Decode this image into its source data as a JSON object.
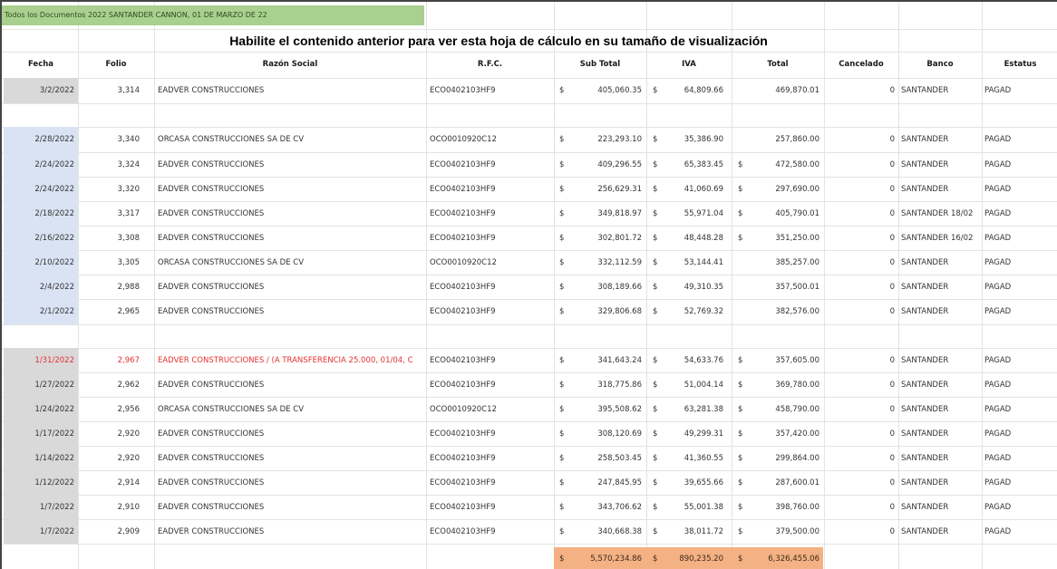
{
  "sheet": {
    "title_cell": "Todos los Documentos 2022 SANTANDER CANNON, 01 DE MARZO DE 22",
    "banner": "Habilite el contenido anterior para ver esta hoja de cálculo en su tamaño de visualización"
  },
  "headers": [
    "Fecha",
    "Folio",
    "Razón Social",
    "R.F.C.",
    "Sub Total",
    "IVA",
    "Total",
    "Cancelado",
    "Banco",
    "Estatus"
  ],
  "rows": [
    {
      "fecha": "3/2/2022",
      "folio": "3,314",
      "razon": "EADVER CONSTRUCCIONES",
      "rfc": "ECO0402103HF9",
      "subtotal": "405,060.35",
      "iva": "64,809.66",
      "total": "469,870.01",
      "cancelado": "0",
      "banco": "SANTANDER",
      "estatus": "PAGAD",
      "group": "gray",
      "red": false,
      "total_dollar": false
    },
    {
      "fecha": "2/28/2022",
      "folio": "3,340",
      "razon": "ORCASA CONSTRUCCIONES SA DE CV",
      "rfc": "OCO0010920C12",
      "subtotal": "223,293.10",
      "iva": "35,386.90",
      "total": "257,860.00",
      "cancelado": "0",
      "banco": "SANTANDER",
      "estatus": "PAGAD",
      "group": "blue",
      "red": false,
      "total_dollar": false
    },
    {
      "fecha": "2/24/2022",
      "folio": "3,324",
      "razon": "EADVER CONSTRUCCIONES",
      "rfc": "ECO0402103HF9",
      "subtotal": "409,296.55",
      "iva": "65,383.45",
      "total": "472,580.00",
      "cancelado": "0",
      "banco": "SANTANDER",
      "estatus": "PAGAD",
      "group": "blue",
      "red": false,
      "total_dollar": true
    },
    {
      "fecha": "2/24/2022",
      "folio": "3,320",
      "razon": "EADVER CONSTRUCCIONES",
      "rfc": "ECO0402103HF9",
      "subtotal": "256,629.31",
      "iva": "41,060.69",
      "total": "297,690.00",
      "cancelado": "0",
      "banco": "SANTANDER",
      "estatus": "PAGAD",
      "group": "blue",
      "red": false,
      "total_dollar": true
    },
    {
      "fecha": "2/18/2022",
      "folio": "3,317",
      "razon": "EADVER CONSTRUCCIONES",
      "rfc": "ECO0402103HF9",
      "subtotal": "349,818.97",
      "iva": "55,971.04",
      "total": "405,790.01",
      "cancelado": "0",
      "banco": "SANTANDER 18/02",
      "estatus": "PAGAD",
      "group": "blue",
      "red": false,
      "total_dollar": true
    },
    {
      "fecha": "2/16/2022",
      "folio": "3,308",
      "razon": "EADVER CONSTRUCCIONES",
      "rfc": "ECO0402103HF9",
      "subtotal": "302,801.72",
      "iva": "48,448.28",
      "total": "351,250.00",
      "cancelado": "0",
      "banco": "SANTANDER 16/02",
      "estatus": "PAGAD",
      "group": "blue",
      "red": false,
      "total_dollar": true
    },
    {
      "fecha": "2/10/2022",
      "folio": "3,305",
      "razon": "ORCASA CONSTRUCCIONES SA DE CV",
      "rfc": "OCO0010920C12",
      "subtotal": "332,112.59",
      "iva": "53,144.41",
      "total": "385,257.00",
      "cancelado": "0",
      "banco": "SANTANDER",
      "estatus": "PAGAD",
      "group": "blue",
      "red": false,
      "total_dollar": false
    },
    {
      "fecha": "2/4/2022",
      "folio": "2,988",
      "razon": "EADVER CONSTRUCCIONES",
      "rfc": "ECO0402103HF9",
      "subtotal": "308,189.66",
      "iva": "49,310.35",
      "total": "357,500.01",
      "cancelado": "0",
      "banco": "SANTANDER",
      "estatus": "PAGAD",
      "group": "blue",
      "red": false,
      "total_dollar": false
    },
    {
      "fecha": "2/1/2022",
      "folio": "2,965",
      "razon": "EADVER CONSTRUCCIONES",
      "rfc": "ECO0402103HF9",
      "subtotal": "329,806.68",
      "iva": "52,769.32",
      "total": "382,576.00",
      "cancelado": "0",
      "banco": "SANTANDER",
      "estatus": "PAGAD",
      "group": "blue",
      "red": false,
      "total_dollar": false
    },
    {
      "fecha": "1/31/2022",
      "folio": "2,967",
      "razon": "EADVER CONSTRUCCIONES / (A TRANSFERENCIA 25.000, 01/04, C",
      "rfc": "ECO0402103HF9",
      "subtotal": "341,643.24",
      "iva": "54,633.76",
      "total": "357,605.00",
      "cancelado": "0",
      "banco": "SANTANDER",
      "estatus": "PAGAD",
      "group": "gray",
      "red": true,
      "total_dollar": true
    },
    {
      "fecha": "1/27/2022",
      "folio": "2,962",
      "razon": "EADVER CONSTRUCCIONES",
      "rfc": "ECO0402103HF9",
      "subtotal": "318,775.86",
      "iva": "51,004.14",
      "total": "369,780.00",
      "cancelado": "0",
      "banco": "SANTANDER",
      "estatus": "PAGAD",
      "group": "gray",
      "red": false,
      "total_dollar": true
    },
    {
      "fecha": "1/24/2022",
      "folio": "2,956",
      "razon": "ORCASA CONSTRUCCIONES SA DE CV",
      "rfc": "OCO0010920C12",
      "subtotal": "395,508.62",
      "iva": "63,281.38",
      "total": "458,790.00",
      "cancelado": "0",
      "banco": "SANTANDER",
      "estatus": "PAGAD",
      "group": "gray",
      "red": false,
      "total_dollar": true
    },
    {
      "fecha": "1/17/2022",
      "folio": "2,920",
      "razon": "EADVER CONSTRUCCIONES",
      "rfc": "ECO0402103HF9",
      "subtotal": "308,120.69",
      "iva": "49,299.31",
      "total": "357,420.00",
      "cancelado": "0",
      "banco": "SANTANDER",
      "estatus": "PAGAD",
      "group": "gray",
      "red": false,
      "total_dollar": true
    },
    {
      "fecha": "1/14/2022",
      "folio": "2,920",
      "razon": "EADVER CONSTRUCCIONES",
      "rfc": "ECO0402103HF9",
      "subtotal": "258,503.45",
      "iva": "41,360.55",
      "total": "299,864.00",
      "cancelado": "0",
      "banco": "SANTANDER",
      "estatus": "PAGAD",
      "group": "gray",
      "red": false,
      "total_dollar": true
    },
    {
      "fecha": "1/12/2022",
      "folio": "2,914",
      "razon": "EADVER CONSTRUCCIONES",
      "rfc": "ECO0402103HF9",
      "subtotal": "247,845.95",
      "iva": "39,655.66",
      "total": "287,600.01",
      "cancelado": "0",
      "banco": "SANTANDER",
      "estatus": "PAGAD",
      "group": "gray",
      "red": false,
      "total_dollar": true
    },
    {
      "fecha": "1/7/2022",
      "folio": "2,910",
      "razon": "EADVER CONSTRUCCIONES",
      "rfc": "ECO0402103HF9",
      "subtotal": "343,706.62",
      "iva": "55,001.38",
      "total": "398,760.00",
      "cancelado": "0",
      "banco": "SANTANDER",
      "estatus": "PAGAD",
      "group": "gray",
      "red": false,
      "total_dollar": true
    },
    {
      "fecha": "1/7/2022",
      "folio": "2,909",
      "razon": "EADVER CONSTRUCCIONES",
      "rfc": "ECO0402103HF9",
      "subtotal": "340,668.38",
      "iva": "38,011.72",
      "total": "379,500.00",
      "cancelado": "0",
      "banco": "SANTANDER",
      "estatus": "PAGAD",
      "group": "gray",
      "red": false,
      "total_dollar": true
    }
  ],
  "totals": {
    "subtotal": "5,570,234.86",
    "iva": "890,235.20",
    "total": "6,326,455.06"
  },
  "colors": {
    "gray_date": "#d9d9d9",
    "blue_date": "#dae3f3",
    "totals_fill": "#f4b183",
    "title_fill": "#a9d08e",
    "red_text": "#e53030"
  }
}
